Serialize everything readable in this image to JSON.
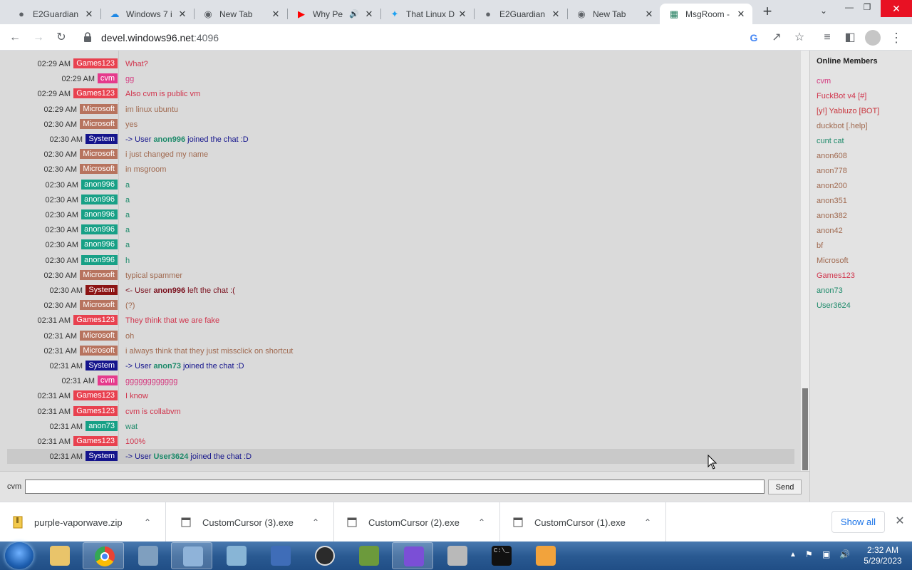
{
  "browser": {
    "tabs": [
      {
        "title": "E2Guardian",
        "icon": "globe-icon"
      },
      {
        "title": "Windows 7 i",
        "icon": "cloud-icon"
      },
      {
        "title": "New Tab",
        "icon": "chrome-icon"
      },
      {
        "title": "Why Pe",
        "icon": "youtube-icon"
      },
      {
        "title": "That Linux D",
        "icon": "twitter-icon"
      },
      {
        "title": "E2Guardian",
        "icon": "globe-icon"
      },
      {
        "title": "New Tab",
        "icon": "chrome-icon"
      },
      {
        "title": "MsgRoom -",
        "icon": "msgroom-icon"
      }
    ],
    "url_host": "devel.windows96.net",
    "url_port": ":4096"
  },
  "chat": {
    "messages": [
      {
        "time": "02:29 AM",
        "user": "Games123",
        "color": "#e8414f",
        "text": "What?",
        "text_color": "#d0344c"
      },
      {
        "time": "02:29 AM",
        "user": "cvm",
        "color": "#e53a8c",
        "text": "gg",
        "text_color": "#d43a7f"
      },
      {
        "time": "02:29 AM",
        "user": "Games123",
        "color": "#e8414f",
        "text": "Also cvm is public vm",
        "text_color": "#d0344c"
      },
      {
        "time": "02:29 AM",
        "user": "Microsoft",
        "color": "#b7735e",
        "text": "im linux ubuntu",
        "text_color": "#a0694f"
      },
      {
        "time": "02:30 AM",
        "user": "Microsoft",
        "color": "#b7735e",
        "text": "yes",
        "text_color": "#a0694f"
      },
      {
        "time": "02:30 AM",
        "user": "System",
        "color": "#14148c",
        "text_pre": "-> User ",
        "text_user": "anon996",
        "text_post": " joined the chat :D",
        "text_color": "#14148c",
        "user_color": "#1d8a6a"
      },
      {
        "time": "02:30 AM",
        "user": "Microsoft",
        "color": "#b7735e",
        "text": "i just changed my name",
        "text_color": "#a0694f"
      },
      {
        "time": "02:30 AM",
        "user": "Microsoft",
        "color": "#b7735e",
        "text": "in msgroom",
        "text_color": "#a0694f"
      },
      {
        "time": "02:30 AM",
        "user": "anon996",
        "color": "#17a086",
        "text": "a",
        "text_color": "#1d8a6a"
      },
      {
        "time": "02:30 AM",
        "user": "anon996",
        "color": "#17a086",
        "text": "a",
        "text_color": "#1d8a6a"
      },
      {
        "time": "02:30 AM",
        "user": "anon996",
        "color": "#17a086",
        "text": "a",
        "text_color": "#1d8a6a"
      },
      {
        "time": "02:30 AM",
        "user": "anon996",
        "color": "#17a086",
        "text": "a",
        "text_color": "#1d8a6a"
      },
      {
        "time": "02:30 AM",
        "user": "anon996",
        "color": "#17a086",
        "text": "a",
        "text_color": "#1d8a6a"
      },
      {
        "time": "02:30 AM",
        "user": "anon996",
        "color": "#17a086",
        "text": "h",
        "text_color": "#1d8a6a"
      },
      {
        "time": "02:30 AM",
        "user": "Microsoft",
        "color": "#b7735e",
        "text": "typical spammer",
        "text_color": "#a0694f"
      },
      {
        "time": "02:30 AM",
        "user": "System",
        "color": "#8c1414",
        "text_pre": "<- User ",
        "text_user": "anon996",
        "text_post": " left the chat :(",
        "text_color": "#7a0f1c",
        "user_color": "#7a0f1c"
      },
      {
        "time": "02:30 AM",
        "user": "Microsoft",
        "color": "#b7735e",
        "text": "(?)",
        "text_color": "#a0694f"
      },
      {
        "time": "02:31 AM",
        "user": "Games123",
        "color": "#e8414f",
        "text": "They think that we are fake",
        "text_color": "#d0344c"
      },
      {
        "time": "02:31 AM",
        "user": "Microsoft",
        "color": "#b7735e",
        "text": "oh",
        "text_color": "#a0694f"
      },
      {
        "time": "02:31 AM",
        "user": "Microsoft",
        "color": "#b7735e",
        "text": "i always think that they just missclick on shortcut",
        "text_color": "#a0694f"
      },
      {
        "time": "02:31 AM",
        "user": "System",
        "color": "#14148c",
        "text_pre": "-> User ",
        "text_user": "anon73",
        "text_post": " joined the chat :D",
        "text_color": "#14148c",
        "user_color": "#1d8a6a"
      },
      {
        "time": "02:31 AM",
        "user": "cvm",
        "color": "#e53a8c",
        "text": "gggggggggggg",
        "text_color": "#d43a7f"
      },
      {
        "time": "02:31 AM",
        "user": "Games123",
        "color": "#e8414f",
        "text": "I know",
        "text_color": "#d0344c"
      },
      {
        "time": "02:31 AM",
        "user": "Games123",
        "color": "#e8414f",
        "text": "cvm is collabvm",
        "text_color": "#d0344c"
      },
      {
        "time": "02:31 AM",
        "user": "anon73",
        "color": "#17a086",
        "text": "wat",
        "text_color": "#1d8a6a"
      },
      {
        "time": "02:31 AM",
        "user": "Games123",
        "color": "#e8414f",
        "text": "100%",
        "text_color": "#d0344c"
      },
      {
        "time": "02:31 AM",
        "user": "System",
        "color": "#14148c",
        "text_pre": "-> User ",
        "text_user": "User3624",
        "text_post": " joined the chat :D",
        "text_color": "#14148c",
        "user_color": "#1d8a6a"
      }
    ],
    "input_nick": "cvm",
    "input_value": "",
    "send_label": "Send"
  },
  "members": {
    "heading": "Online Members",
    "list": [
      {
        "name": "cvm",
        "color": "#d43a7f"
      },
      {
        "name": "FuckBot v4 [#]",
        "color": "#d0344c"
      },
      {
        "name": "[y!] Yabluzo [BOT]",
        "color": "#c8343c"
      },
      {
        "name": "duckbot [.help]",
        "color": "#a0694f"
      },
      {
        "name": "cunt cat",
        "color": "#1d8a6a"
      },
      {
        "name": "anon608",
        "color": "#a0694f"
      },
      {
        "name": "anon778",
        "color": "#a0694f"
      },
      {
        "name": "anon200",
        "color": "#a0694f"
      },
      {
        "name": "anon351",
        "color": "#a0694f"
      },
      {
        "name": "anon382",
        "color": "#a0694f"
      },
      {
        "name": "anon42",
        "color": "#a0694f"
      },
      {
        "name": "bf",
        "color": "#a0694f"
      },
      {
        "name": "Microsoft",
        "color": "#a0694f"
      },
      {
        "name": "Games123",
        "color": "#d0344c"
      },
      {
        "name": "anon73",
        "color": "#1d8a6a"
      },
      {
        "name": "User3624",
        "color": "#1d8a6a"
      }
    ]
  },
  "downloads": {
    "items": [
      {
        "name": "purple-vaporwave.zip",
        "icon": "zip-file-icon"
      },
      {
        "name": "CustomCursor (3).exe",
        "icon": "exe-file-icon"
      },
      {
        "name": "CustomCursor (2).exe",
        "icon": "exe-file-icon"
      },
      {
        "name": "CustomCursor (1).exe",
        "icon": "exe-file-icon"
      }
    ],
    "show_all_label": "Show all"
  },
  "taskbar": {
    "apps": [
      "explorer-icon",
      "chrome-icon",
      "monitor-icon",
      "control-panel-icon",
      "notepad-icon",
      "app-icon",
      "obs-icon",
      "frog-icon",
      "visual-studio-icon",
      "archive-icon",
      "terminal-icon",
      "google-app-icon"
    ],
    "time": "2:32 AM",
    "date": "5/29/2023"
  }
}
